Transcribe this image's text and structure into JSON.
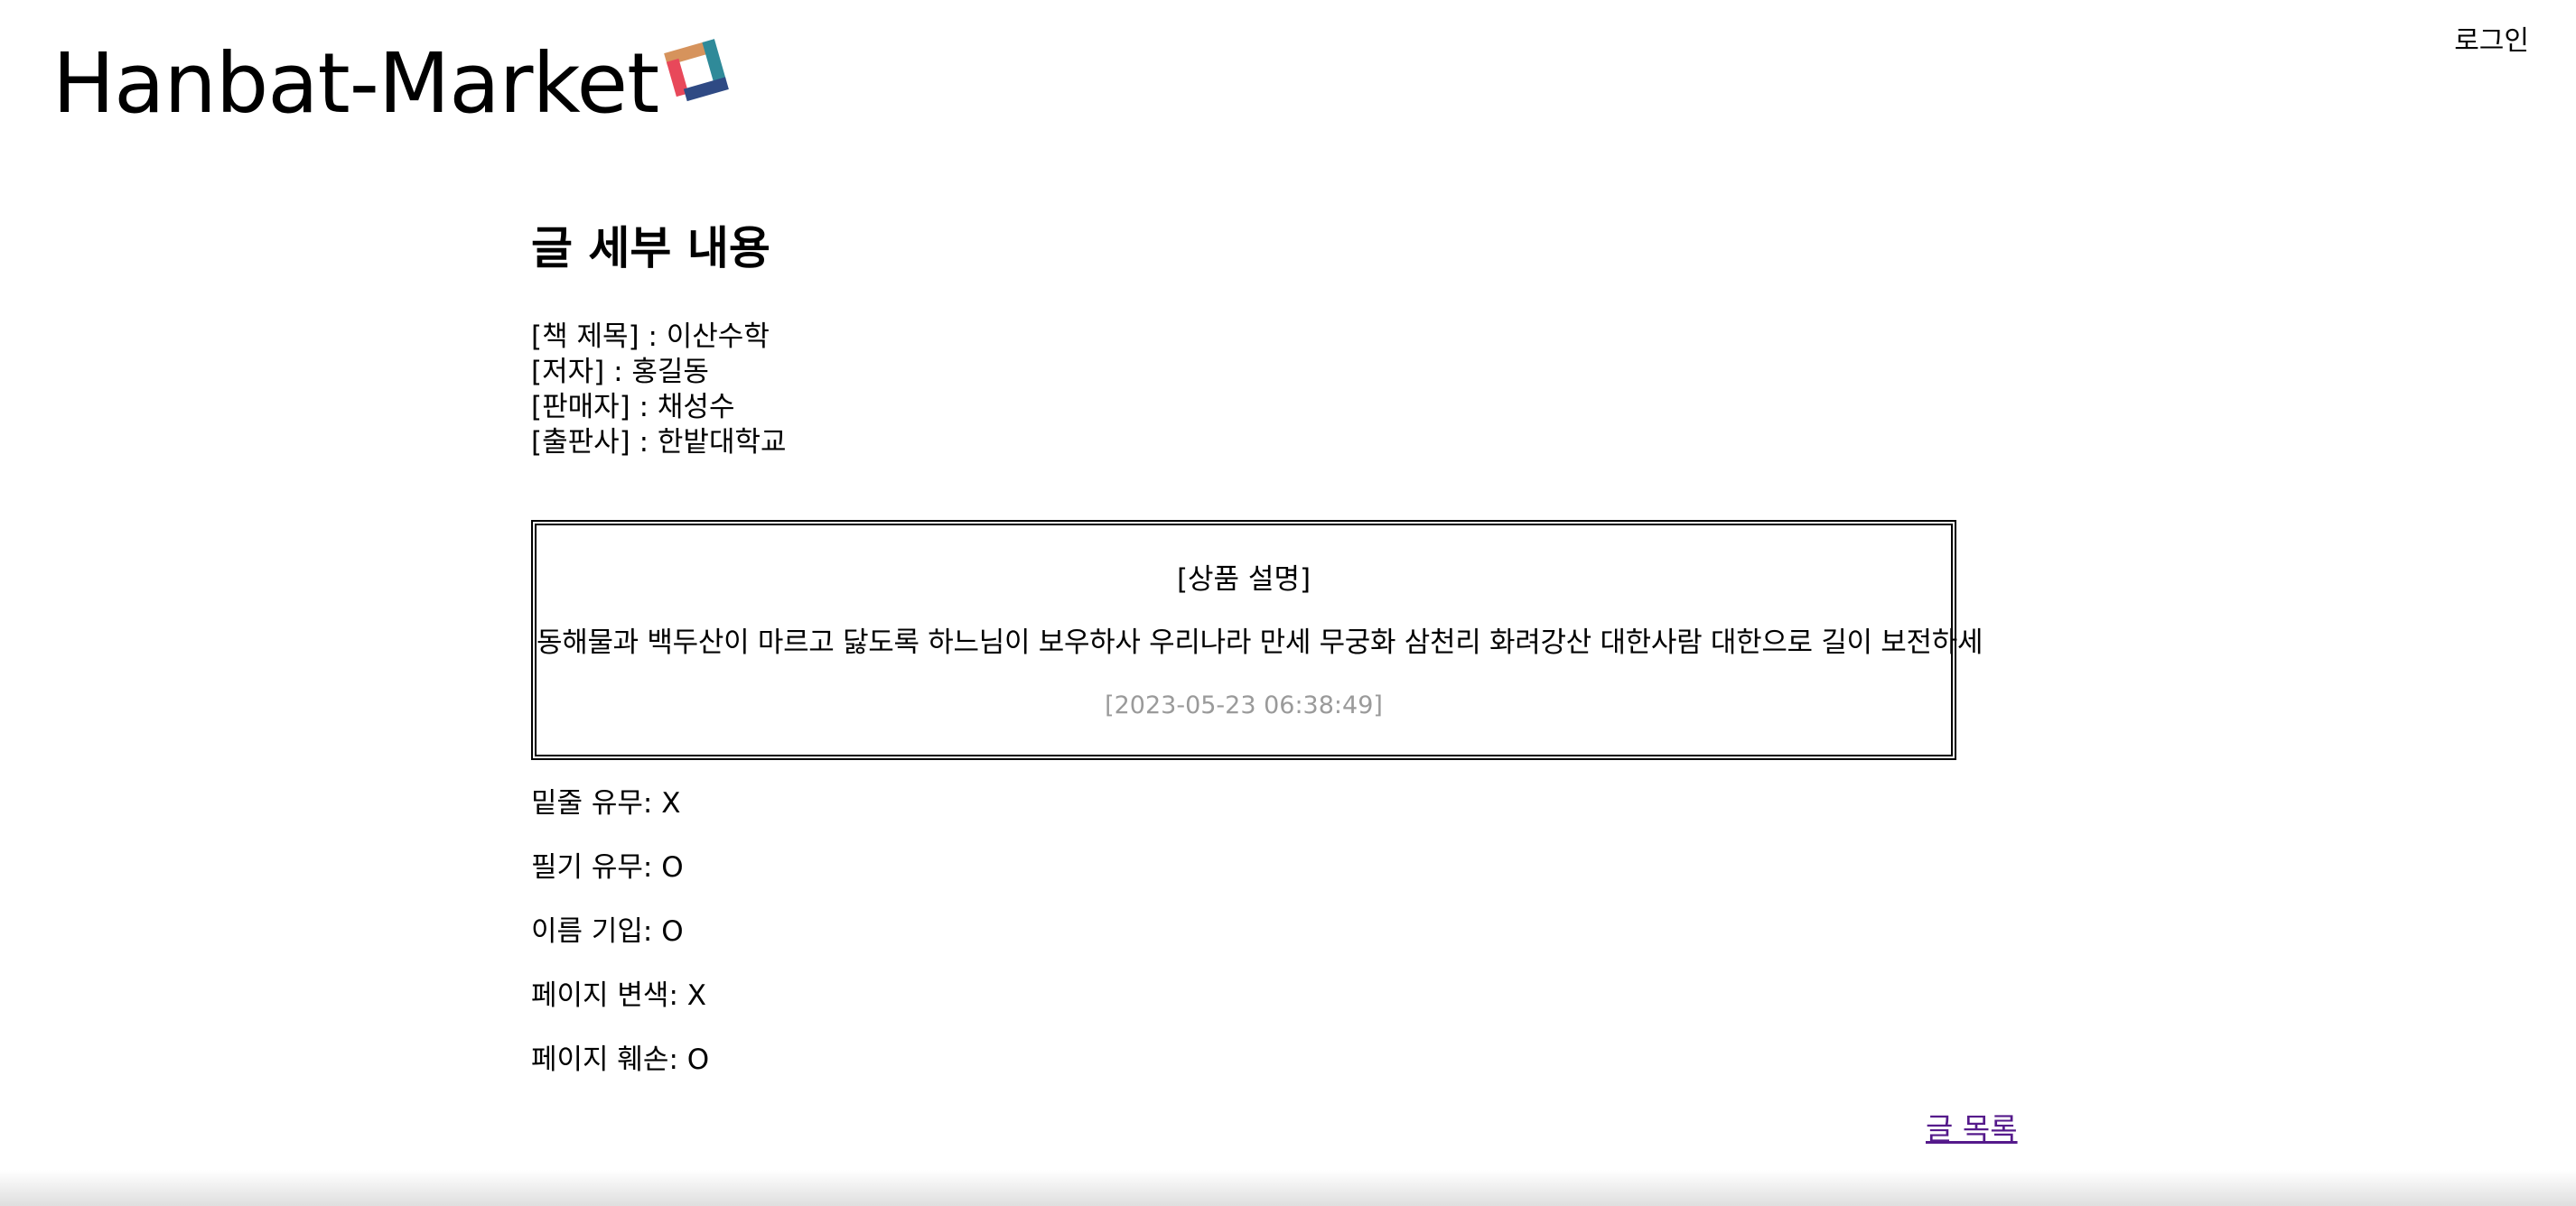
{
  "header": {
    "site_title": "Hanbat-Market",
    "login_label": "로그인",
    "logo_colors": [
      "#d6935c",
      "#e8485a",
      "#2f8a99",
      "#2f4a84"
    ]
  },
  "post": {
    "section_title": "글 세부 내용",
    "meta": {
      "book_title": "[책 제목] : 이산수학",
      "author": "[저자] : 홍길동",
      "seller": "[판매자] : 채성수",
      "publisher": "[출판사] : 한밭대학교"
    },
    "description": {
      "title": "[상품 설명]",
      "body": "동해물과 백두산이 마르고 닳도록 하느님이 보우하사 우리나라 만세 무궁화 삼천리 화려강산 대한사람 대한으로 길이 보전하세",
      "date": "[2023-05-23 06:38:49]"
    },
    "conditions": {
      "underline": "밑줄 유무: X",
      "notes": "필기 유무: O",
      "name_written": "이름 기입: O",
      "discoloration": "페이지 변색: X",
      "damage": "페이지 훼손: O"
    },
    "list_link_label": "글 목록"
  }
}
